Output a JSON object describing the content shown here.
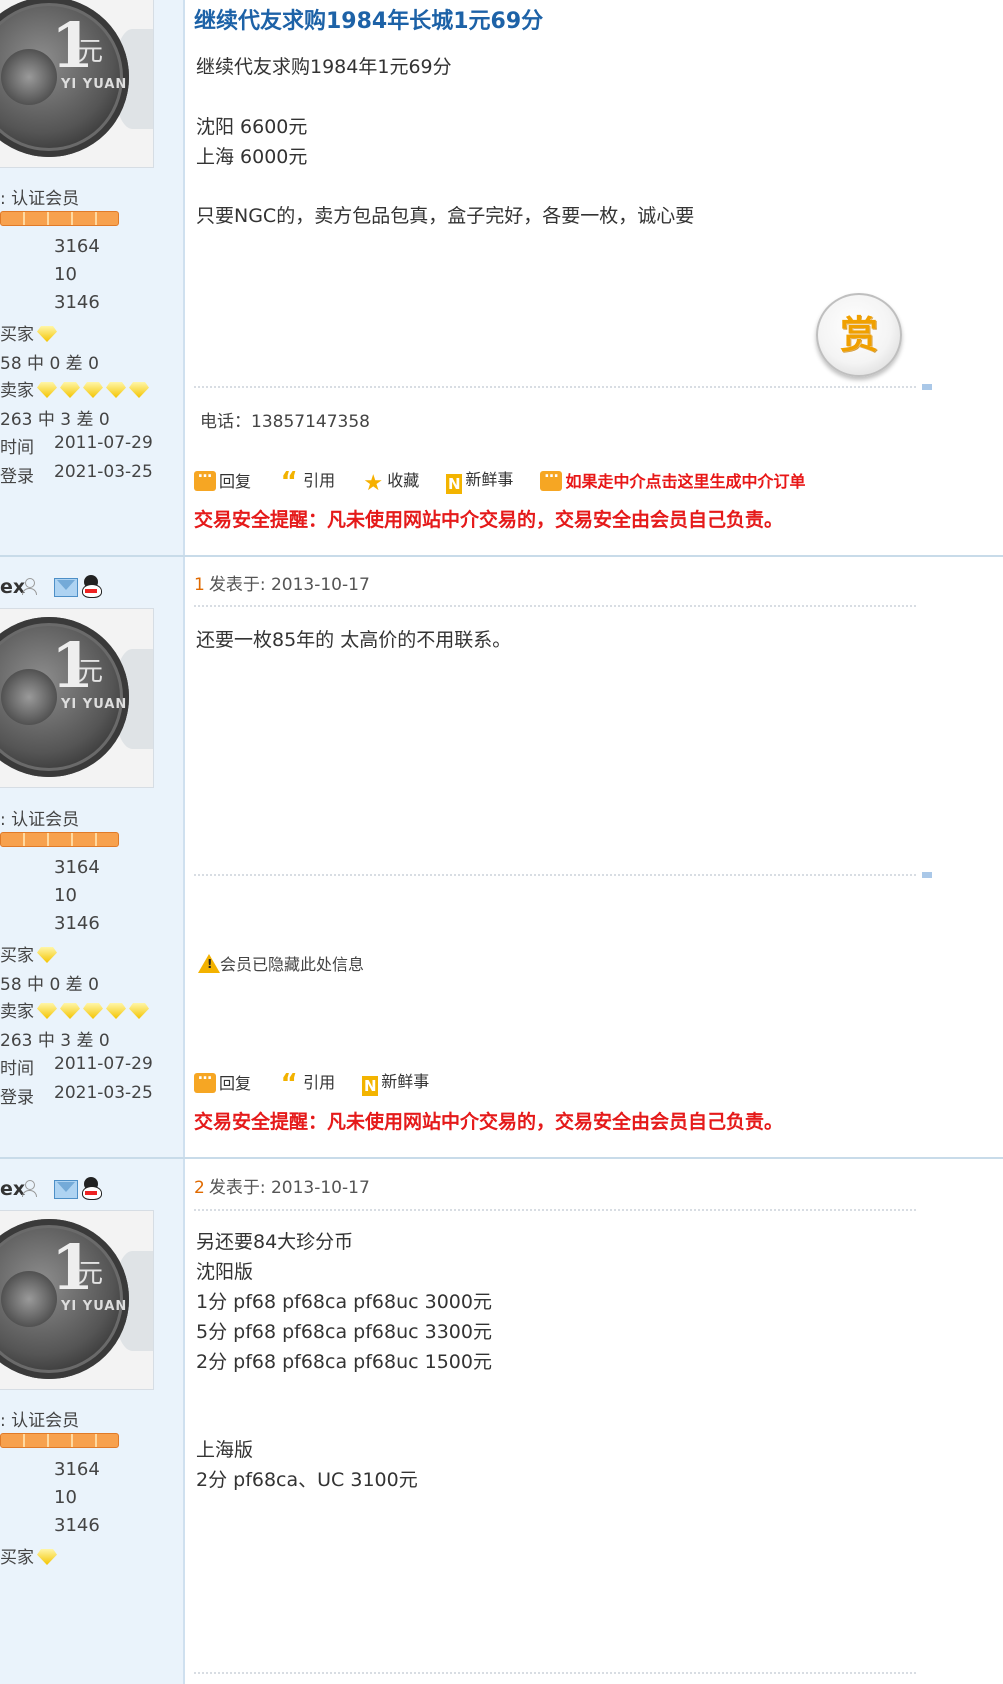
{
  "colors": {
    "title": "#1d62a7",
    "warning": "#e51a1a",
    "sidebar_bg": "#eaf3fb",
    "floor_number": "#e06a00"
  },
  "posts": [
    {
      "title": "继续代友求购1984年长城1元69分",
      "lines": [
        "继续代友求购1984年1元69分",
        "沈阳 6600元",
        "上海 6000元",
        "只要NGC的，卖方包品包真，盒子完好，各要一枚，诚心要"
      ],
      "reward_label": "赏",
      "phone": "电话：13857147358",
      "actions": [
        "回复",
        "引用",
        "收藏",
        "新鲜事"
      ],
      "escrow_link": "如果走中介点击这里生成中介订单",
      "warning": "交易安全提醒：凡未使用网站中介交易的，交易安全由会员自己负责。"
    },
    {
      "floor": "1",
      "posted": "发表于: 2013-10-17",
      "lines": [
        "还要一枚85年的    太高价的不用联系。"
      ],
      "hidden_notice": "会员已隐藏此处信息",
      "actions": [
        "回复",
        "引用",
        "新鲜事"
      ],
      "warning": "交易安全提醒：凡未使用网站中介交易的，交易安全由会员自己负责。"
    },
    {
      "floor": "2",
      "posted": "发表于: 2013-10-17",
      "lines": [
        "另还要84大珍分币",
        "沈阳版",
        "1分 pf68 pf68ca pf68uc    3000元",
        "5分 pf68 pf68ca pf68uc    3300元",
        "2分 pf68 pf68ca pf68uc   1500元",
        "上海版",
        "2分 pf68ca、UC              3100元"
      ]
    }
  ],
  "author": {
    "name_fragment": "ex",
    "coin_text": {
      "one": "1",
      "yuan": "元",
      "latin": "YI YUAN"
    },
    "member_type": ": 认证会员",
    "stats": [
      "3164",
      "10",
      "3146"
    ],
    "buyer_label": "买家",
    "buyer_record": "58 中 0 差 0",
    "seller_label": "卖家",
    "seller_record": "263 中 3 差 0",
    "reg_label": "时间",
    "reg_date": "2011-07-29",
    "login_label": "登录",
    "login_date": "2021-03-25"
  },
  "icons": {
    "user": "user-icon",
    "mail": "mail-icon",
    "qq": "qq-icon",
    "reply": "reply-icon",
    "quote": "quote-icon",
    "favorite": "star-icon",
    "news": "news-icon",
    "warning": "warning-icon",
    "diamond": "diamond-icon"
  }
}
